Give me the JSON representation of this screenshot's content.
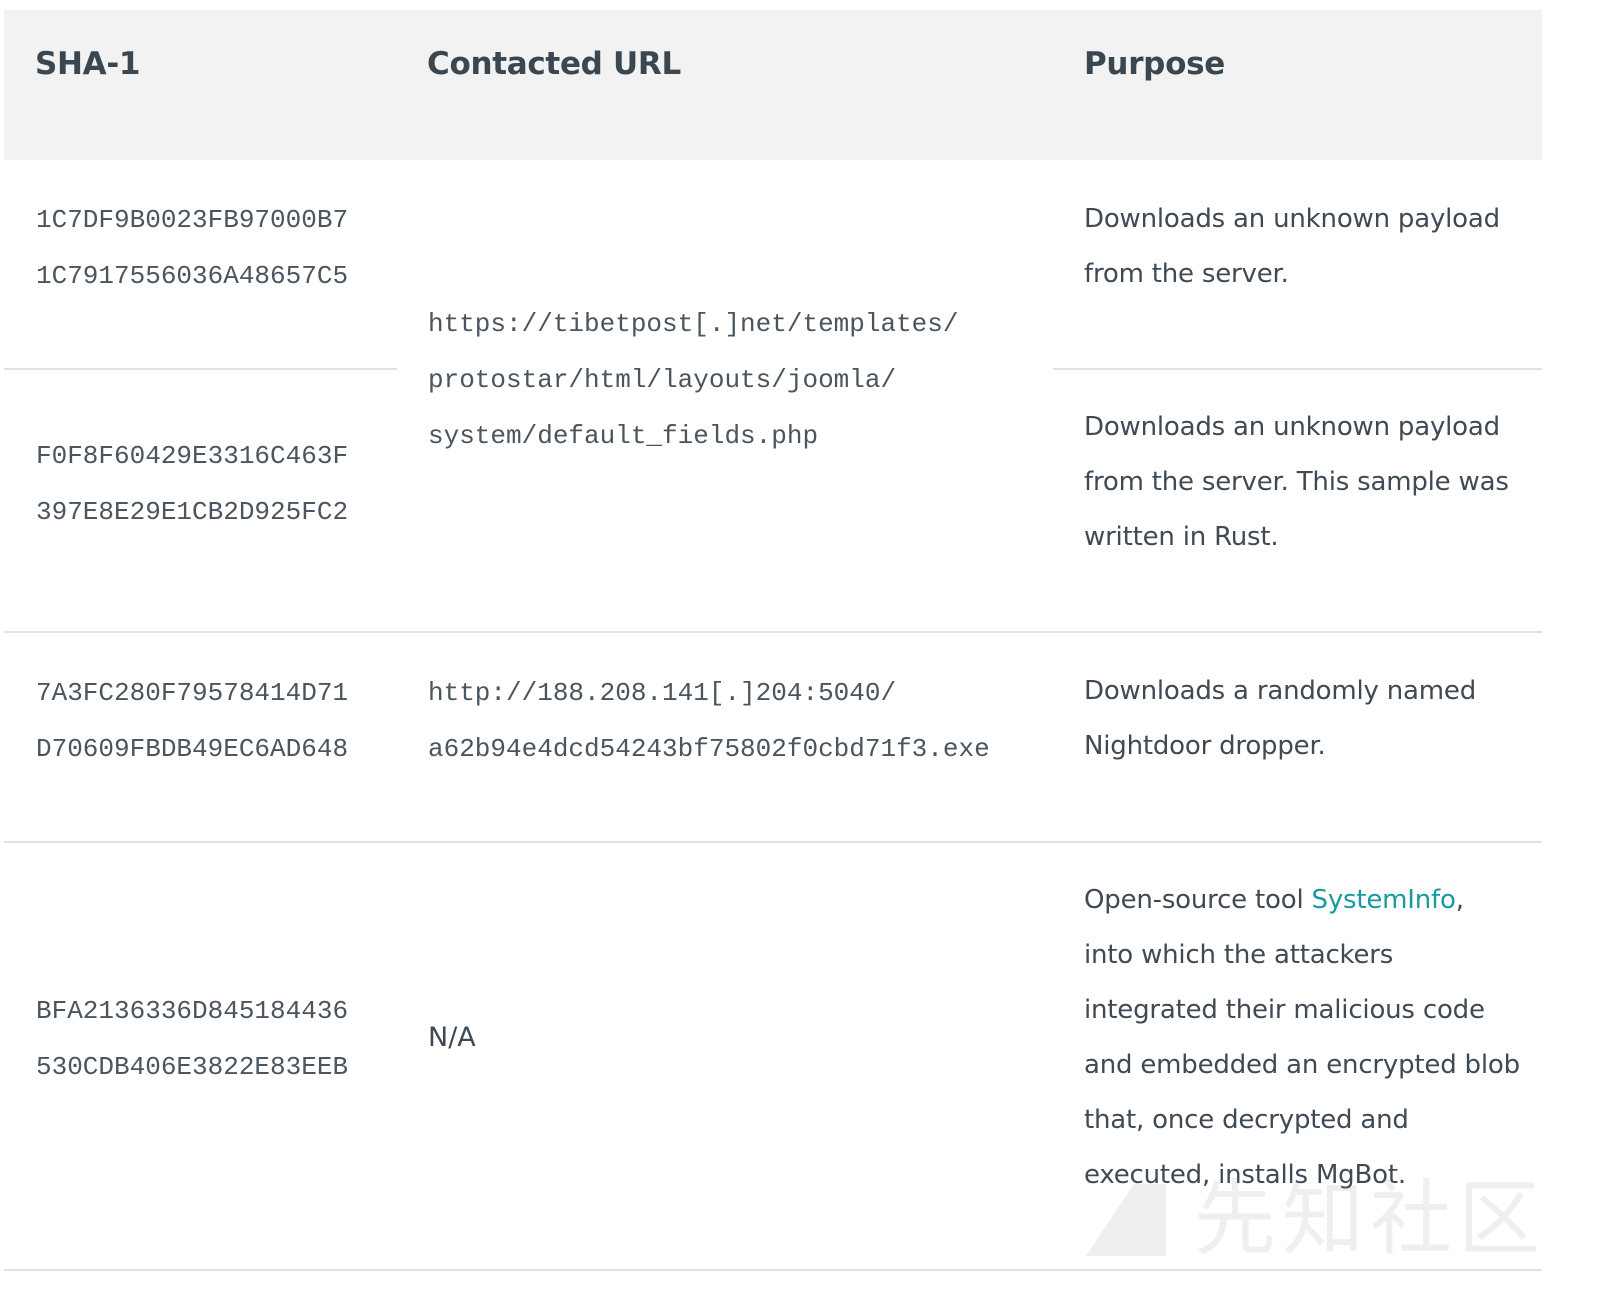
{
  "table": {
    "headers": {
      "sha1": "SHA-1",
      "url": "Contacted URL",
      "purpose": "Purpose"
    },
    "rows": [
      {
        "sha1_samples": [
          [
            "1C7DF9B0023FB97000B7",
            "1C7917556036A48657C5"
          ],
          [
            "F0F8F60429E3316C463F",
            "397E8E29E1CB2D925FC2"
          ]
        ],
        "url_lines": [
          "https://tibetpost[.]net/templates/",
          "protostar/html/layouts/joomla/",
          "system/default_fields.php"
        ],
        "purposes": [
          [
            "Downloads an unknown payload",
            "from the server."
          ],
          [
            "Downloads an unknown payload",
            "from the server. This sample was",
            "written in Rust."
          ]
        ]
      },
      {
        "sha1_lines": [
          "7A3FC280F79578414D71",
          "D70609FBDB49EC6AD648"
        ],
        "url_lines": [
          "http://188.208.141[.]204:5040/",
          "a62b94e4dcd54243bf75802f0cbd71f3.exe"
        ],
        "purpose_lines": [
          "Downloads a randomly named",
          "Nightdoor dropper."
        ]
      },
      {
        "sha1_lines": [
          "BFA2136336D845184436",
          "530CDB406E3822E83EEB"
        ],
        "url": "N/A",
        "purpose": {
          "prefix": "Open-source tool ",
          "link_text": "SystemInfo",
          "suffix": ",",
          "lines": [
            "into which the attackers",
            "integrated their malicious code",
            "and embedded an encrypted blob",
            "that, once decrypted and",
            "executed, installs MgBot."
          ]
        }
      }
    ]
  },
  "watermark": {
    "text": "先知社区"
  },
  "colors": {
    "header_bg": "#f2f2f2",
    "text": "#3f4a55",
    "link": "#1a9aa0",
    "divider": "#e2e2e2"
  }
}
